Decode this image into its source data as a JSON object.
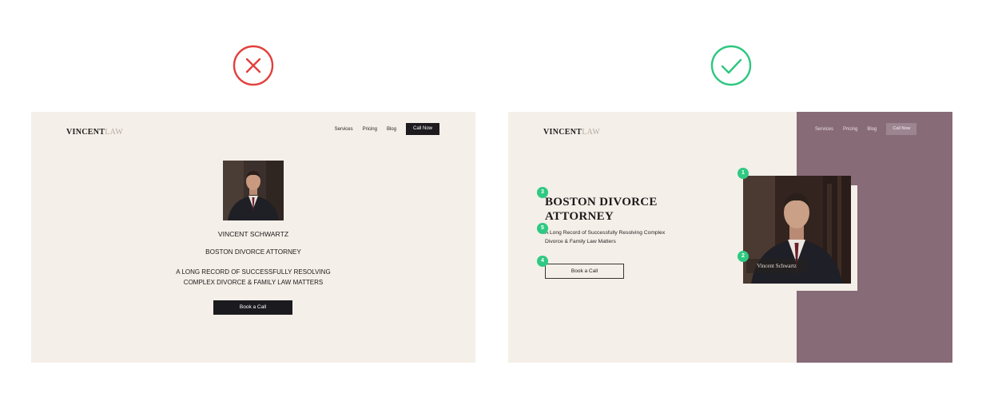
{
  "colors": {
    "bad": "#e2403c",
    "good": "#2ec77f",
    "panel_bg": "#f4efe8",
    "purple": "#876b77",
    "dark": "#1e1b1e"
  },
  "icons": {
    "bad": "x-circle-icon",
    "good": "check-circle-icon"
  },
  "bad_example": {
    "logo_bold": "VINCENT",
    "logo_light": "LAW",
    "nav": [
      "Services",
      "Pricing",
      "Blog"
    ],
    "cta": "Call Now",
    "name": "VINCENT SCHWARTZ",
    "title": "BOSTON DIVORCE ATTORNEY",
    "description_line1": "A LONG RECORD OF SUCCESSFULLY RESOLVING",
    "description_line2": "COMPLEX DIVORCE & FAMILY LAW MATTERS",
    "button": "Book a Call"
  },
  "good_example": {
    "logo_bold": "VINCENT",
    "logo_light": "LAW",
    "nav": [
      "Services",
      "Pricing",
      "Blog"
    ],
    "cta": "Call Now",
    "headline_line1": "BOSTON DIVORCE",
    "headline_line2": "ATTORNEY",
    "subtext_line1": "A Long Record of Successfully Resolving Complex",
    "subtext_line2": "Divorce & Family Law Matters",
    "button": "Book a Call",
    "caption": "Vincent Schwartz",
    "badges": [
      "1",
      "2",
      "3",
      "4",
      "5"
    ]
  }
}
